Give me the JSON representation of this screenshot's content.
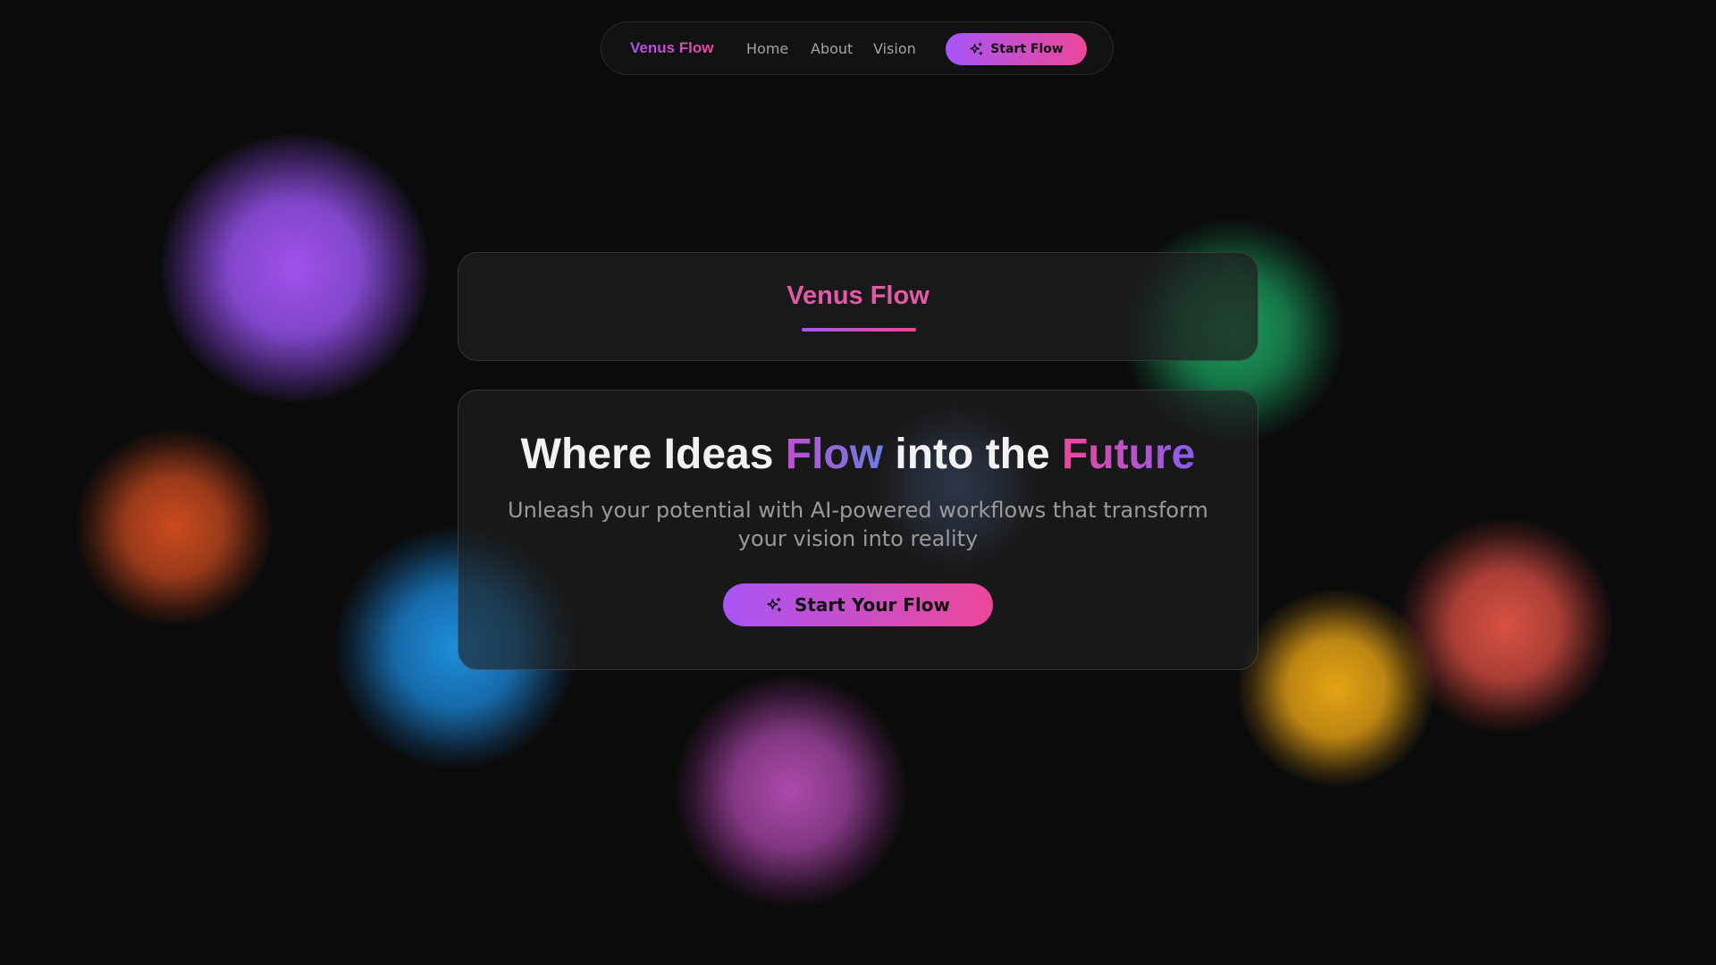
{
  "nav": {
    "brand": "Venus Flow",
    "links": [
      {
        "label": "Home"
      },
      {
        "label": "About"
      },
      {
        "label": "Vision"
      }
    ],
    "cta_label": "Start Flow",
    "cta_icon": "sparkle-icon"
  },
  "title_card": {
    "heading": "Venus Flow"
  },
  "hero": {
    "heading_part1": "Where Ideas ",
    "heading_highlight1": "Flow",
    "heading_part2": " into the ",
    "heading_highlight2": "Future",
    "subtitle": "Unleash your potential with AI-powered workflows that transform your vision into reality",
    "cta_label": "Start Your Flow",
    "cta_icon": "sparkle-icon"
  },
  "colors": {
    "background": "#0b0b0b",
    "accent_purple": "#a855f7",
    "accent_pink": "#ec4899",
    "card_text": "#f2f2f2",
    "muted_text": "#9a9a9a"
  }
}
